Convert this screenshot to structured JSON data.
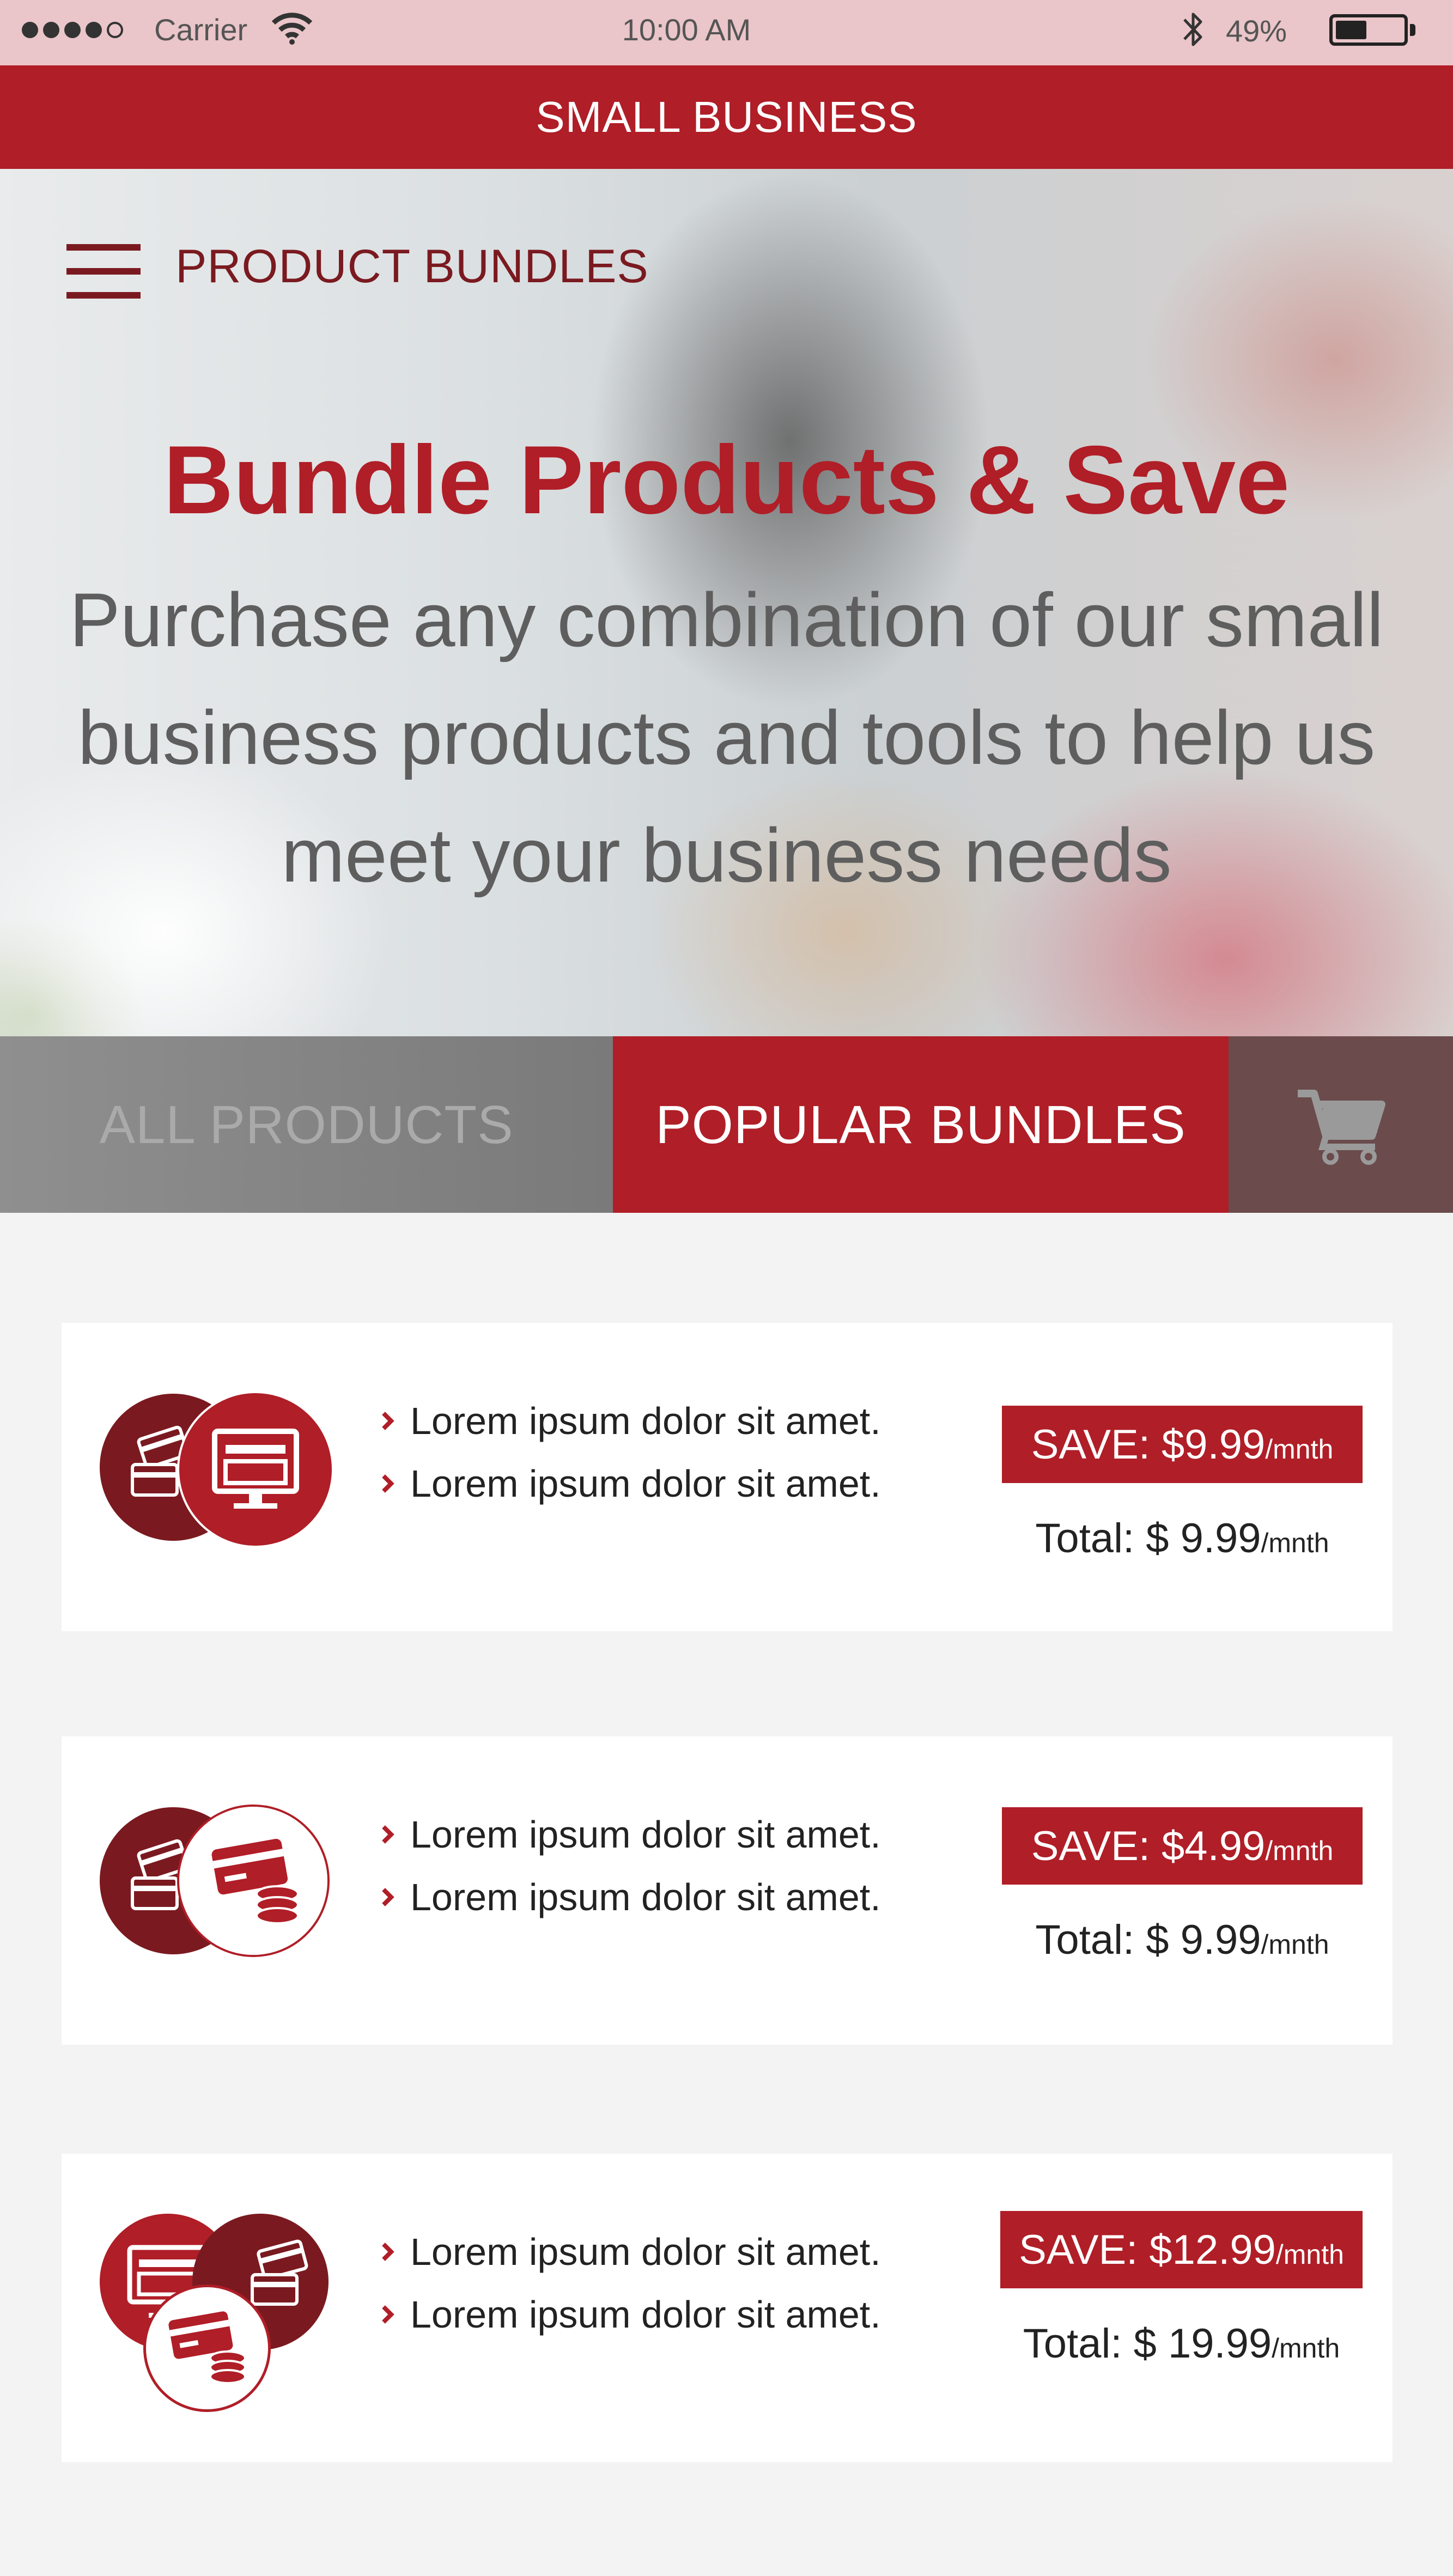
{
  "status_bar": {
    "carrier": "Carrier",
    "time": "10:00 AM",
    "battery_percent": "49%",
    "signal_bars_filled": 4,
    "signal_bars_total": 5,
    "battery_level": 0.49
  },
  "app_bar": {
    "title": "SMALL BUSINESS"
  },
  "hero": {
    "section_label": "PRODUCT BUNDLES",
    "title": "Bundle Products & Save",
    "subtitle": "Purchase any combination of our small business products and tools to help us meet your business needs"
  },
  "tabs": {
    "all_products": "ALL PRODUCTS",
    "popular_bundles": "POPULAR BUNDLES",
    "active": "popular_bundles"
  },
  "bundles": [
    {
      "icons": [
        "credit-cards-icon",
        "computer-monitor-icon"
      ],
      "features": [
        "Lorem ipsum dolor sit amet.",
        "Lorem ipsum dolor sit amet."
      ],
      "save_label": "SAVE: $9.99",
      "save_unit": "/mnth",
      "total_label": "Total: $ 9.99",
      "total_unit": "/mnth"
    },
    {
      "icons": [
        "credit-cards-icon",
        "card-and-coins-icon"
      ],
      "features": [
        "Lorem ipsum dolor sit amet.",
        "Lorem ipsum dolor sit amet."
      ],
      "save_label": "SAVE: $4.99",
      "save_unit": "/mnth",
      "total_label": "Total: $ 9.99",
      "total_unit": "/mnth"
    },
    {
      "icons": [
        "computer-monitor-icon",
        "credit-cards-icon",
        "card-and-coins-icon"
      ],
      "features": [
        "Lorem ipsum dolor sit amet.",
        "Lorem ipsum dolor sit amet."
      ],
      "save_label": "SAVE: $12.99",
      "save_unit": "/mnth",
      "total_label": "Total: $ 19.99",
      "total_unit": "/mnth"
    }
  ],
  "colors": {
    "brand_red": "#b01e27",
    "dark_red": "#7a1a20",
    "background": "#f3f3f3"
  }
}
